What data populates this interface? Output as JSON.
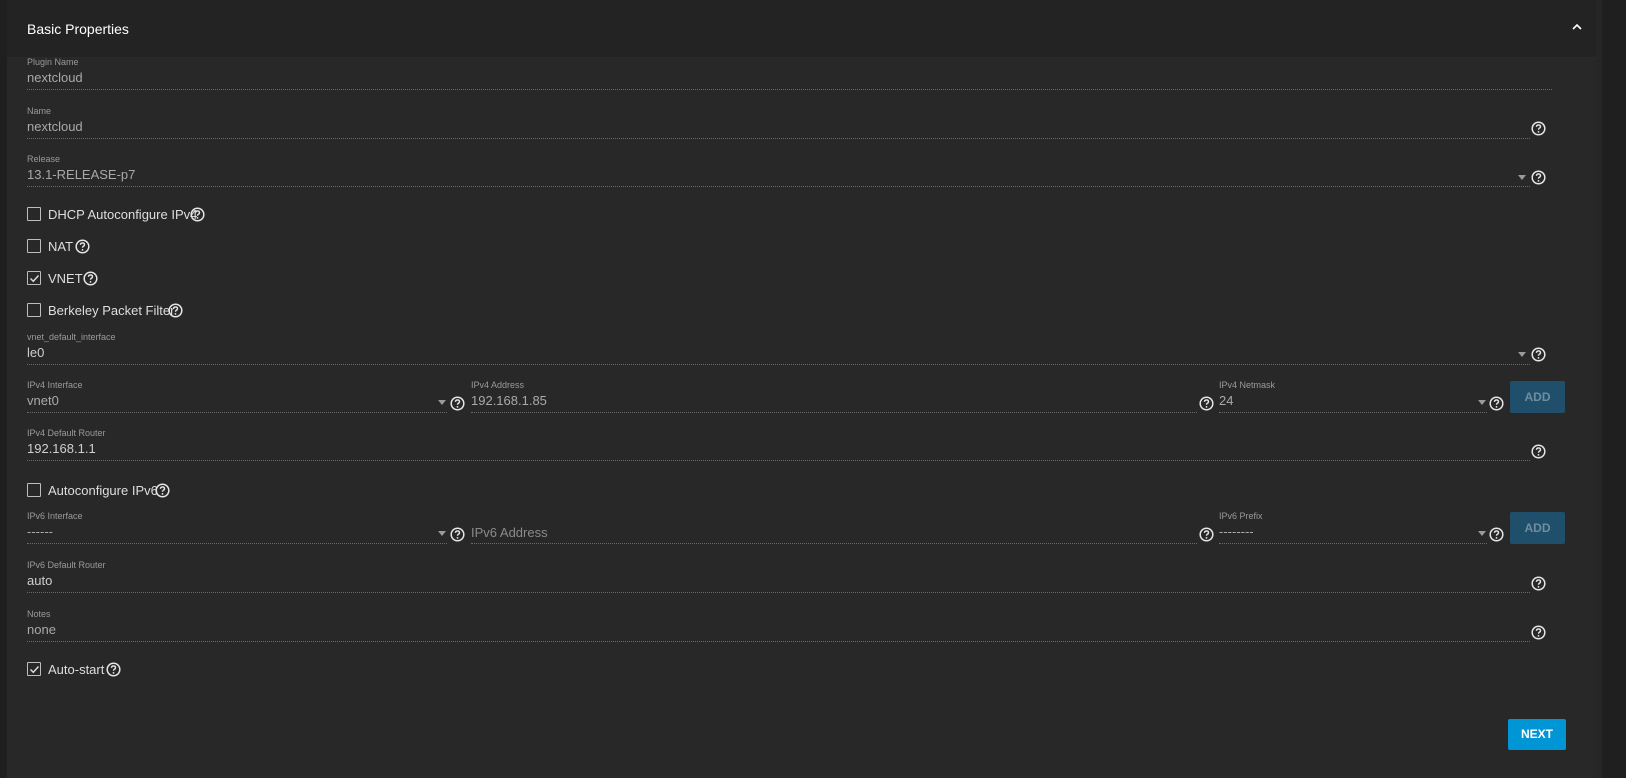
{
  "header": {
    "title": "Basic Properties"
  },
  "fields": {
    "plugin_name": {
      "label": "Plugin Name",
      "value": "nextcloud"
    },
    "name": {
      "label": "Name",
      "value": "nextcloud"
    },
    "release": {
      "label": "Release",
      "value": "13.1-RELEASE-p7"
    },
    "vnet_default_interface": {
      "label": "vnet_default_interface",
      "value": "le0"
    },
    "ipv4_interface": {
      "label": "IPv4 Interface",
      "value": "vnet0"
    },
    "ipv4_address": {
      "label": "IPv4 Address",
      "value": "192.168.1.85"
    },
    "ipv4_netmask": {
      "label": "IPv4 Netmask",
      "value": "24"
    },
    "ipv4_default_router": {
      "label": "IPv4 Default Router",
      "value": "192.168.1.1"
    },
    "ipv6_interface": {
      "label": "IPv6 Interface",
      "value": "------"
    },
    "ipv6_address": {
      "label": "",
      "placeholder": "IPv6 Address"
    },
    "ipv6_prefix": {
      "label": "IPv6 Prefix",
      "value": "--------"
    },
    "ipv6_default_router": {
      "label": "IPv6 Default Router",
      "value": "auto"
    },
    "notes": {
      "label": "Notes",
      "value": "none"
    }
  },
  "checkboxes": {
    "dhcp": {
      "label": "DHCP Autoconfigure IPv4",
      "checked": false
    },
    "nat": {
      "label": "NAT",
      "checked": false
    },
    "vnet": {
      "label": "VNET",
      "checked": true
    },
    "bpf": {
      "label": "Berkeley Packet Filter",
      "checked": false
    },
    "autoconf_ipv6": {
      "label": "Autoconfigure IPv6",
      "checked": false
    },
    "autostart": {
      "label": "Auto-start",
      "checked": true
    }
  },
  "buttons": {
    "add_ipv4": "ADD",
    "add_ipv6": "ADD",
    "next": "NEXT"
  },
  "icons": {
    "help": "help-circle-icon",
    "dropdown": "dropdown-arrow-icon",
    "collapse": "chevron-up-icon",
    "check": "check-icon"
  },
  "colors": {
    "accent": "#0095d5",
    "add_button": "#1f4f6b",
    "background": "#282828"
  }
}
